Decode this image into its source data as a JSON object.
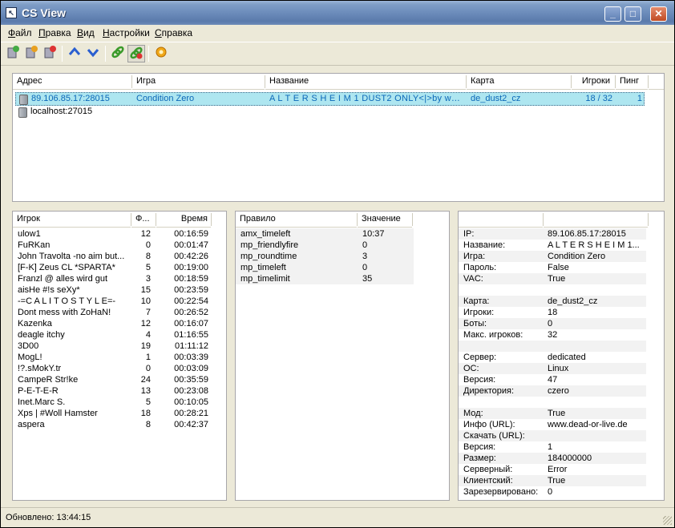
{
  "window": {
    "title": "CS View"
  },
  "titlebar_buttons": {
    "minimize": "_",
    "maximize": "□",
    "close": "✕"
  },
  "menu": [
    "Файл",
    "Правка",
    "Вид",
    "Настройки",
    "Справка"
  ],
  "toolbar": {
    "icons": [
      "add-server-icon",
      "refresh-server-icon",
      "remove-server-icon",
      "move-up-icon",
      "move-down-icon",
      "connect-icon",
      "connect-all-icon",
      "settings-icon"
    ]
  },
  "servers": {
    "columns": [
      "Адрес",
      "Игра",
      "Название",
      "Карта",
      "Игроки",
      "Пинг"
    ],
    "rows": [
      {
        "address": "89.106.85.17:28015",
        "game": "Condition Zero",
        "name": "A L T E R S H E I M 1 DUST2 ONLY<|>by www....",
        "map": "de_dust2_cz",
        "players": "18 / 32",
        "ping": "1"
      },
      {
        "address": "localhost:27015",
        "game": "",
        "name": "",
        "map": "",
        "players": "",
        "ping": ""
      }
    ]
  },
  "players": {
    "columns": [
      "Игрок",
      "Ф...",
      "Время"
    ],
    "rows": [
      {
        "name": "ulow1",
        "frags": "12",
        "time": "00:16:59"
      },
      {
        "name": "FuRKan",
        "frags": "0",
        "time": "00:01:47"
      },
      {
        "name": "John Travolta -no aim but...",
        "frags": "8",
        "time": "00:42:26"
      },
      {
        "name": "[F-K] Zeus CL *SPARTA*",
        "frags": "5",
        "time": "00:19:00"
      },
      {
        "name": "Franzl @ alles wird gut",
        "frags": "3",
        "time": "00:18:59"
      },
      {
        "name": "aisHe #!s seXy*",
        "frags": "15",
        "time": "00:23:59"
      },
      {
        "name": "-=C A L I T O S T Y L E=-",
        "frags": "10",
        "time": "00:22:54"
      },
      {
        "name": "Dont mess with ZoHaN!",
        "frags": "7",
        "time": "00:26:52"
      },
      {
        "name": "Kazenka",
        "frags": "12",
        "time": "00:16:07"
      },
      {
        "name": "deagle itchy",
        "frags": "4",
        "time": "01:16:55"
      },
      {
        "name": "3D00",
        "frags": "19",
        "time": "01:11:12"
      },
      {
        "name": "MogL!",
        "frags": "1",
        "time": "00:03:39"
      },
      {
        "name": "!?.sMokY.tr",
        "frags": "0",
        "time": "00:03:09"
      },
      {
        "name": "CampeR Str!ke",
        "frags": "24",
        "time": "00:35:59"
      },
      {
        "name": "P-E-T-E-R",
        "frags": "13",
        "time": "00:23:08"
      },
      {
        "name": "Inet.Marc S.",
        "frags": "5",
        "time": "00:10:05"
      },
      {
        "name": "Xps | #Woll Hamster",
        "frags": "18",
        "time": "00:28:21"
      },
      {
        "name": "aspera",
        "frags": "8",
        "time": "00:42:37"
      }
    ]
  },
  "rules": {
    "columns": [
      "Правило",
      "Значение"
    ],
    "rows": [
      {
        "rule": "amx_timeleft",
        "value": "10:37"
      },
      {
        "rule": "mp_friendlyfire",
        "value": "0"
      },
      {
        "rule": "mp_roundtime",
        "value": "3"
      },
      {
        "rule": "mp_timeleft",
        "value": "0"
      },
      {
        "rule": "mp_timelimit",
        "value": "35"
      }
    ]
  },
  "info": {
    "rows": [
      {
        "key": "IP:",
        "value": "89.106.85.17:28015"
      },
      {
        "key": "Название:",
        "value": "A L T E R S H E I M 1..."
      },
      {
        "key": "Игра:",
        "value": "Condition Zero"
      },
      {
        "key": "Пароль:",
        "value": "False"
      },
      {
        "key": "VAC:",
        "value": "True"
      },
      {
        "key": "",
        "value": ""
      },
      {
        "key": "Карта:",
        "value": "de_dust2_cz"
      },
      {
        "key": "Игроки:",
        "value": "18"
      },
      {
        "key": "Боты:",
        "value": "0"
      },
      {
        "key": "Макс. игроков:",
        "value": "32"
      },
      {
        "key": "",
        "value": ""
      },
      {
        "key": "Сервер:",
        "value": "dedicated"
      },
      {
        "key": "ОС:",
        "value": "Linux"
      },
      {
        "key": "Версия:",
        "value": "47"
      },
      {
        "key": "Директория:",
        "value": "czero"
      },
      {
        "key": "",
        "value": ""
      },
      {
        "key": "Мод:",
        "value": "True"
      },
      {
        "key": "Инфо (URL):",
        "value": "www.dead-or-live.de"
      },
      {
        "key": "Скачать (URL):",
        "value": ""
      },
      {
        "key": "Версия:",
        "value": "1"
      },
      {
        "key": "Размер:",
        "value": "184000000"
      },
      {
        "key": "Серверный:",
        "value": "Error"
      },
      {
        "key": "Клиентский:",
        "value": "True"
      },
      {
        "key": "Зарезервировано:",
        "value": "0"
      }
    ]
  },
  "status": {
    "text": "Обновлено: 13:44:15"
  }
}
